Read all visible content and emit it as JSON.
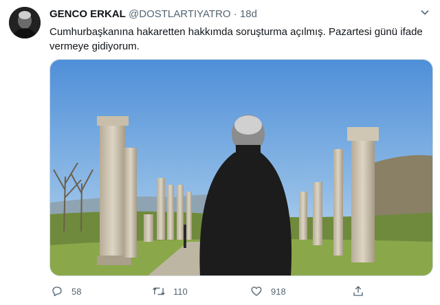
{
  "author": {
    "name": "GENCO ERKAL",
    "handle": "@DOSTLARTIYATRO",
    "separator": "·",
    "time": "18d"
  },
  "tweet": {
    "text": "Cumhurbaşkanına hakaretten hakkımda soruşturma açılmış. Pazartesi günü ifade vermeye gidiyorum."
  },
  "actions": {
    "reply_count": "58",
    "retweet_count": "110",
    "like_count": "918"
  },
  "icons": {
    "more": "chevron-down-icon",
    "reply": "reply-icon",
    "retweet": "retweet-icon",
    "like": "heart-icon",
    "share": "share-icon"
  },
  "colors": {
    "text": "#0f1419",
    "secondary": "#536471",
    "border": "#cfd9de"
  }
}
